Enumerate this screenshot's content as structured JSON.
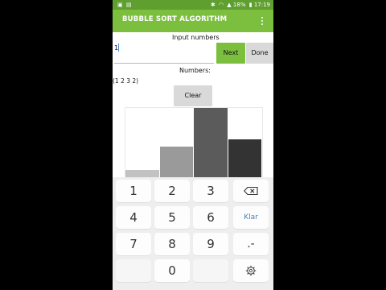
{
  "status": {
    "time": "17:19",
    "battery": "18%",
    "icons": [
      "bluetooth-icon",
      "wifi-icon",
      "signal-icon",
      "battery-icon"
    ]
  },
  "app": {
    "title": "BUBBLE SORT ALGORITHM",
    "overflow_icon": "overflow-menu-icon"
  },
  "form": {
    "input_label": "Input numbers",
    "input_value": "1",
    "next_label": "Next",
    "done_label": "Done",
    "numbers_label": "Numbers:",
    "numbers_value": "(1 2 3 2)",
    "clear_label": "Clear"
  },
  "chart_data": {
    "type": "bar",
    "values": [
      1,
      4,
      9,
      5
    ],
    "colors": [
      "#c2c2c2",
      "#9a9a9a",
      "#5b5b5b",
      "#333333"
    ]
  },
  "keyboard": {
    "rows": [
      [
        "1",
        "2",
        "3",
        "backspace"
      ],
      [
        "4",
        "5",
        "6",
        "Klar"
      ],
      [
        "7",
        "8",
        "9",
        ".-"
      ],
      [
        "",
        "0",
        "",
        "settings"
      ]
    ]
  },
  "colors": {
    "accent": "#7cbf3f",
    "statusbar": "#5f9f2f"
  }
}
